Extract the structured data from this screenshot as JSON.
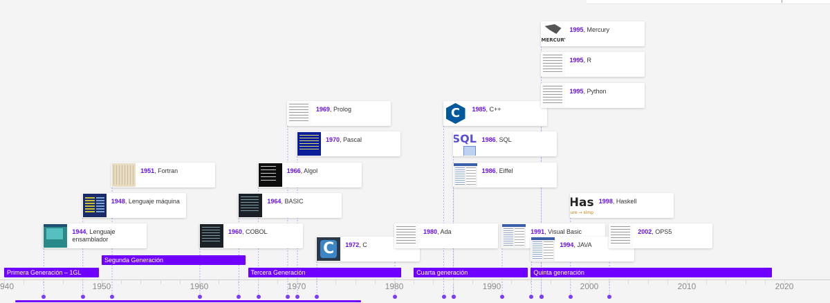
{
  "colors": {
    "accent": "#6f00ff",
    "year": "#6610f2"
  },
  "timeline": {
    "axis": {
      "start_year": 1940,
      "end_year": 2020,
      "step": 10,
      "labels": [
        "940",
        "1950",
        "1960",
        "1970",
        "1980",
        "1990",
        "2000",
        "2010",
        "2020"
      ]
    },
    "eras": [
      {
        "label": "Primera Generación – 1GL",
        "from": 1940,
        "to": 1950
      },
      {
        "label": "Segunda Generación",
        "from": 1950,
        "to": 1965
      },
      {
        "label": "Tercera Generación",
        "from": 1965,
        "to": 1981
      },
      {
        "label": "Cuarta generación",
        "from": 1982,
        "to": 1994
      },
      {
        "label": "Quinta generación",
        "from": 1994,
        "to": 2019
      }
    ],
    "events": [
      {
        "year": "1944",
        "name": "Lenguaje ensamblador",
        "thumb": "screen-teal-icon",
        "row": 7
      },
      {
        "year": "1948",
        "name": "Lenguaje máquina",
        "thumb": "screen-navy-icon",
        "row": 6
      },
      {
        "year": "1951",
        "name": "Fortran",
        "thumb": "punchcard-icon",
        "row": 5
      },
      {
        "year": "1960",
        "name": "COBOL",
        "thumb": "screen-dark-icon",
        "row": 7
      },
      {
        "year": "1964",
        "name": "BASIC",
        "thumb": "screen-dark-icon",
        "row": 6
      },
      {
        "year": "1966",
        "name": "Algol",
        "thumb": "screen-black-icon",
        "row": 5
      },
      {
        "year": "1969",
        "name": "Prolog",
        "thumb": "code-doc-icon",
        "row": 3
      },
      {
        "year": "1970",
        "name": "Pascal",
        "thumb": "screen-blue-icon",
        "row": 4
      },
      {
        "year": "1972",
        "name": "C",
        "thumb": "c-logo-icon",
        "row": 8
      },
      {
        "year": "1980",
        "name": "Ada",
        "thumb": "code-doc-icon",
        "row": 7
      },
      {
        "year": "1985",
        "name": "C++",
        "thumb": "cpp-logo-icon",
        "row": 3
      },
      {
        "year": "1986",
        "name": "SQL",
        "thumb": "sql-logo-icon",
        "row": 4
      },
      {
        "year": "1986",
        "name": "Eiffel",
        "thumb": "ide-screenshot-icon",
        "row": 5
      },
      {
        "year": "1991",
        "name": "Visual Basic",
        "thumb": "ide-screenshot-icon",
        "row": 7
      },
      {
        "year": "1994",
        "name": "JAVA",
        "thumb": "ide-screenshot-icon",
        "row": 8
      },
      {
        "year": "1995",
        "name": "Mercury",
        "thumb": "mercury-logo-icon",
        "row": 0
      },
      {
        "year": "1995",
        "name": "R",
        "thumb": "code-doc-icon",
        "row": 1
      },
      {
        "year": "1995",
        "name": "Python",
        "thumb": "code-doc-icon",
        "row": 2
      },
      {
        "year": "1998",
        "name": "Haskell",
        "thumb": "haskell-logo-icon",
        "row": 6
      },
      {
        "year": "2002",
        "name": "OPS5",
        "thumb": "code-doc-icon",
        "row": 7
      }
    ],
    "logo_text": {
      "mercury": "MERCURY",
      "sql": "SQL",
      "haskell": "Hask",
      "haskell_tagline": "ure → simp"
    }
  }
}
